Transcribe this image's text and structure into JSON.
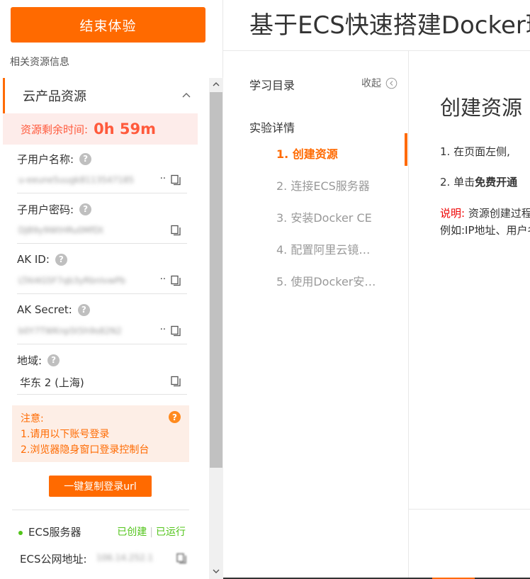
{
  "left": {
    "end_button": "结束体验",
    "section_label": "相关资源信息",
    "card_title": "云产品资源",
    "timer_label": "资源剩余时间:",
    "timer_value": "0h 59m",
    "fields": [
      {
        "label": "子用户名称:",
        "value": "u-eeune5uugk8113547185",
        "ellipsis": "··"
      },
      {
        "label": "子用户密码:",
        "value": "DJ89y9WtHRu0MfDt",
        "ellipsis": ""
      },
      {
        "label": "AK ID:",
        "value": "LTAI4G5F7qb3yRbnIvwPb",
        "ellipsis": "··"
      },
      {
        "label": "AK Secret:",
        "value": "b0Y7TWKnp5t5h9s82N2",
        "ellipsis": "··"
      },
      {
        "label": "地域:",
        "value": "华东 2 (上海)",
        "ellipsis": ""
      }
    ],
    "notice": {
      "title": "注意:",
      "line1": "1.请用以下账号登录",
      "line2": "2.浏览器隐身窗口登录控制台"
    },
    "copy_url_button": "一键复制登录url",
    "ecs": {
      "name": "ECS服务器",
      "status_created": "已创建",
      "status_running": "已运行"
    },
    "ip": {
      "label": "ECS公网地址:",
      "value": "106.14.252.1"
    }
  },
  "title": "基于ECS快速搭建Docker环境",
  "catalog": {
    "title": "学习目录",
    "collapse": "收起",
    "section": "实验详情",
    "items": [
      "1. 创建资源",
      "2. 连接ECS服务器",
      "3. 安装Docker CE",
      "4. 配置阿里云镜…",
      "5. 使用Docker安…"
    ]
  },
  "content": {
    "heading": "创建资源",
    "step1": "1.  在页面左侧,",
    "step2_prefix": "2.  单击",
    "step2_bold": "免费开通",
    "note_label": "说明:",
    "note_text": " 资源创建过程",
    "note_line2": "例如:IP地址、用户名"
  },
  "colors": {
    "accent": "#ff6a00",
    "success": "#52c41a",
    "timer": "#ff5a3c"
  }
}
